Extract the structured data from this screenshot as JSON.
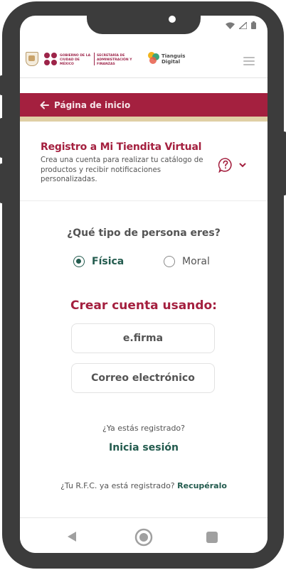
{
  "header": {
    "gob_line1": "GOBIERNO DE LA",
    "gob_line2": "CIUDAD DE MÉXICO",
    "sec_line1": "SECRETARÍA DE",
    "sec_line2": "ADMINISTRACIÓN Y FINANZAS",
    "tianguis_line1": "Tianguis",
    "tianguis_line2": "Digital"
  },
  "nav": {
    "back_label": "Página de inicio"
  },
  "intro": {
    "title": "Registro a Mi Tiendita Virtual",
    "subtitle": "Crea una cuenta para realizar tu catálogo de productos y recibir notificaciones personalizadas."
  },
  "person_type": {
    "question": "¿Qué tipo de persona eres?",
    "options": [
      {
        "label": "Física",
        "selected": true
      },
      {
        "label": "Moral",
        "selected": false
      }
    ]
  },
  "create": {
    "title": "Crear cuenta usando:",
    "efirma_label": "e.firma",
    "email_label": "Correo electrónico"
  },
  "login": {
    "already_text": "¿Ya estás registrado?",
    "login_label": "Inicia sesión"
  },
  "rfc": {
    "text": "¿Tu R.F.C. ya está registrado?",
    "link_label": "Recupéralo"
  },
  "colors": {
    "brand_primary": "#a4203f",
    "brand_green": "#235b4e",
    "accent_gold": "#e0cfa5"
  }
}
